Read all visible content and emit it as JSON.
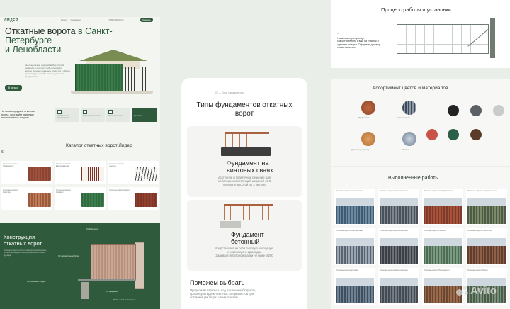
{
  "left": {
    "logo": "ЛИДЕР",
    "nav": [
      "Каталог",
      "О компании",
      "Монтаж",
      "Контакты"
    ],
    "phone": "+7 (812) 000-00-00",
    "header_button": "Заказать",
    "hero_title_1": "Откатные ворота",
    "hero_title_2": " в Санкт-Петербурге",
    "hero_title_3": "и Ленобласти",
    "hero_text": "Мы предлагаем широкий выбор стилей, дизайнов и отделок, чтобы подобрать ворота, которые идеально впишутся в общую архитектуру и дизайн вашего дома или предприятия",
    "hero_button": "В каталог",
    "benefits_text": "Не только продаём откатные ворота, но и даём приятные впечатления от покупки",
    "benefits": [
      "Собственное производство",
      "Гарантия на монтаж",
      "Замер бесплатно",
      "Доставка"
    ],
    "catalog_title": "Каталог откатных ворот Лидер",
    "catalog_count": "6",
    "catalog_items": [
      "Откатные ворота Профнастил",
      "Откатные ворота Евроштакетник",
      "Откатные ворота Жалюзи",
      "Откатные ворота Решётка",
      "Откатные ворота Сэндвич",
      "Откатные ворота Ранчо"
    ],
    "construction_title_1": "Конструкция",
    "construction_title_2": "откатных ворот",
    "construction_text": "Откатные ворота состоят из нескольких основных элементов, каждый из которых выполняет свою функцию",
    "construction_labels": [
      "01 Рама ворот",
      "02 Направляющая балка",
      "03 Роликовые опоры",
      "04 Фундамент",
      "05 Концевой улавливатель"
    ]
  },
  "center": {
    "breadcrumb": "02 — Типы фундаментов",
    "title_1": "Типы фундаментов откатных",
    "title_2": "ворот",
    "f1_title_1": "Фундамент на",
    "f1_title_2": "винтовых сваях",
    "f1_text_1": "доступное и практичное решение для",
    "f1_text_2": "небольших конструкций шириной от 3",
    "f1_text_3": "метров и высотой до 3 метров",
    "f2_title_1": "Фундамент",
    "f2_title_2": "бетонный",
    "f2_text_1": "представляет из себя силовую закладную",
    "f2_text_2": "из швеллера и арматуры.",
    "f2_text_3": "Заливается бетоном марки не ниже М200",
    "help_title": "Поможем выбрать",
    "help_text_1": "Предложим варианты под различные бюджеты,",
    "help_text_2": "проконсультируем опытных специалистов для",
    "help_text_3": "оптимизации затрат на материалы"
  },
  "right": {
    "process_title": "Процесс работы и установки",
    "process_step": "01",
    "process_text_1": "Наши мастера приедут",
    "process_text_2": "самостоятельно к вам на участок и",
    "process_text_3": "сделают замеры. Оформим договор",
    "process_text_4": "прямо на месте",
    "assortment_title": "Ассортимент цветов и материалов",
    "materials": [
      "Профнастил",
      "Евроштакетник",
      "Дерево под покраску",
      "Жалюзи"
    ],
    "colors": [
      "#232323",
      "#5b6064",
      "#c9cbcd",
      "#c95146",
      "#2c6048",
      "#5c3a28"
    ],
    "works_title": "Выполненные работы",
    "works_captions": [
      "Откатные ворота из штакетника",
      "Откатные ворота Евроштакетник",
      "Откатные ворота из профнастила",
      "Откатные ворота с вертикальным",
      "Откатные ворота из штакетника",
      "Откатные ворота Евроштакетник",
      "Откатные ворота Решетка",
      "Откатные ворота с калиткой",
      "Откатные ворота Жалюзи",
      "Откатные ворота Евроштакетник",
      "Откатные ворота Профнастил",
      "Откатные ворота Ранчо"
    ],
    "watermark": "Avito"
  }
}
